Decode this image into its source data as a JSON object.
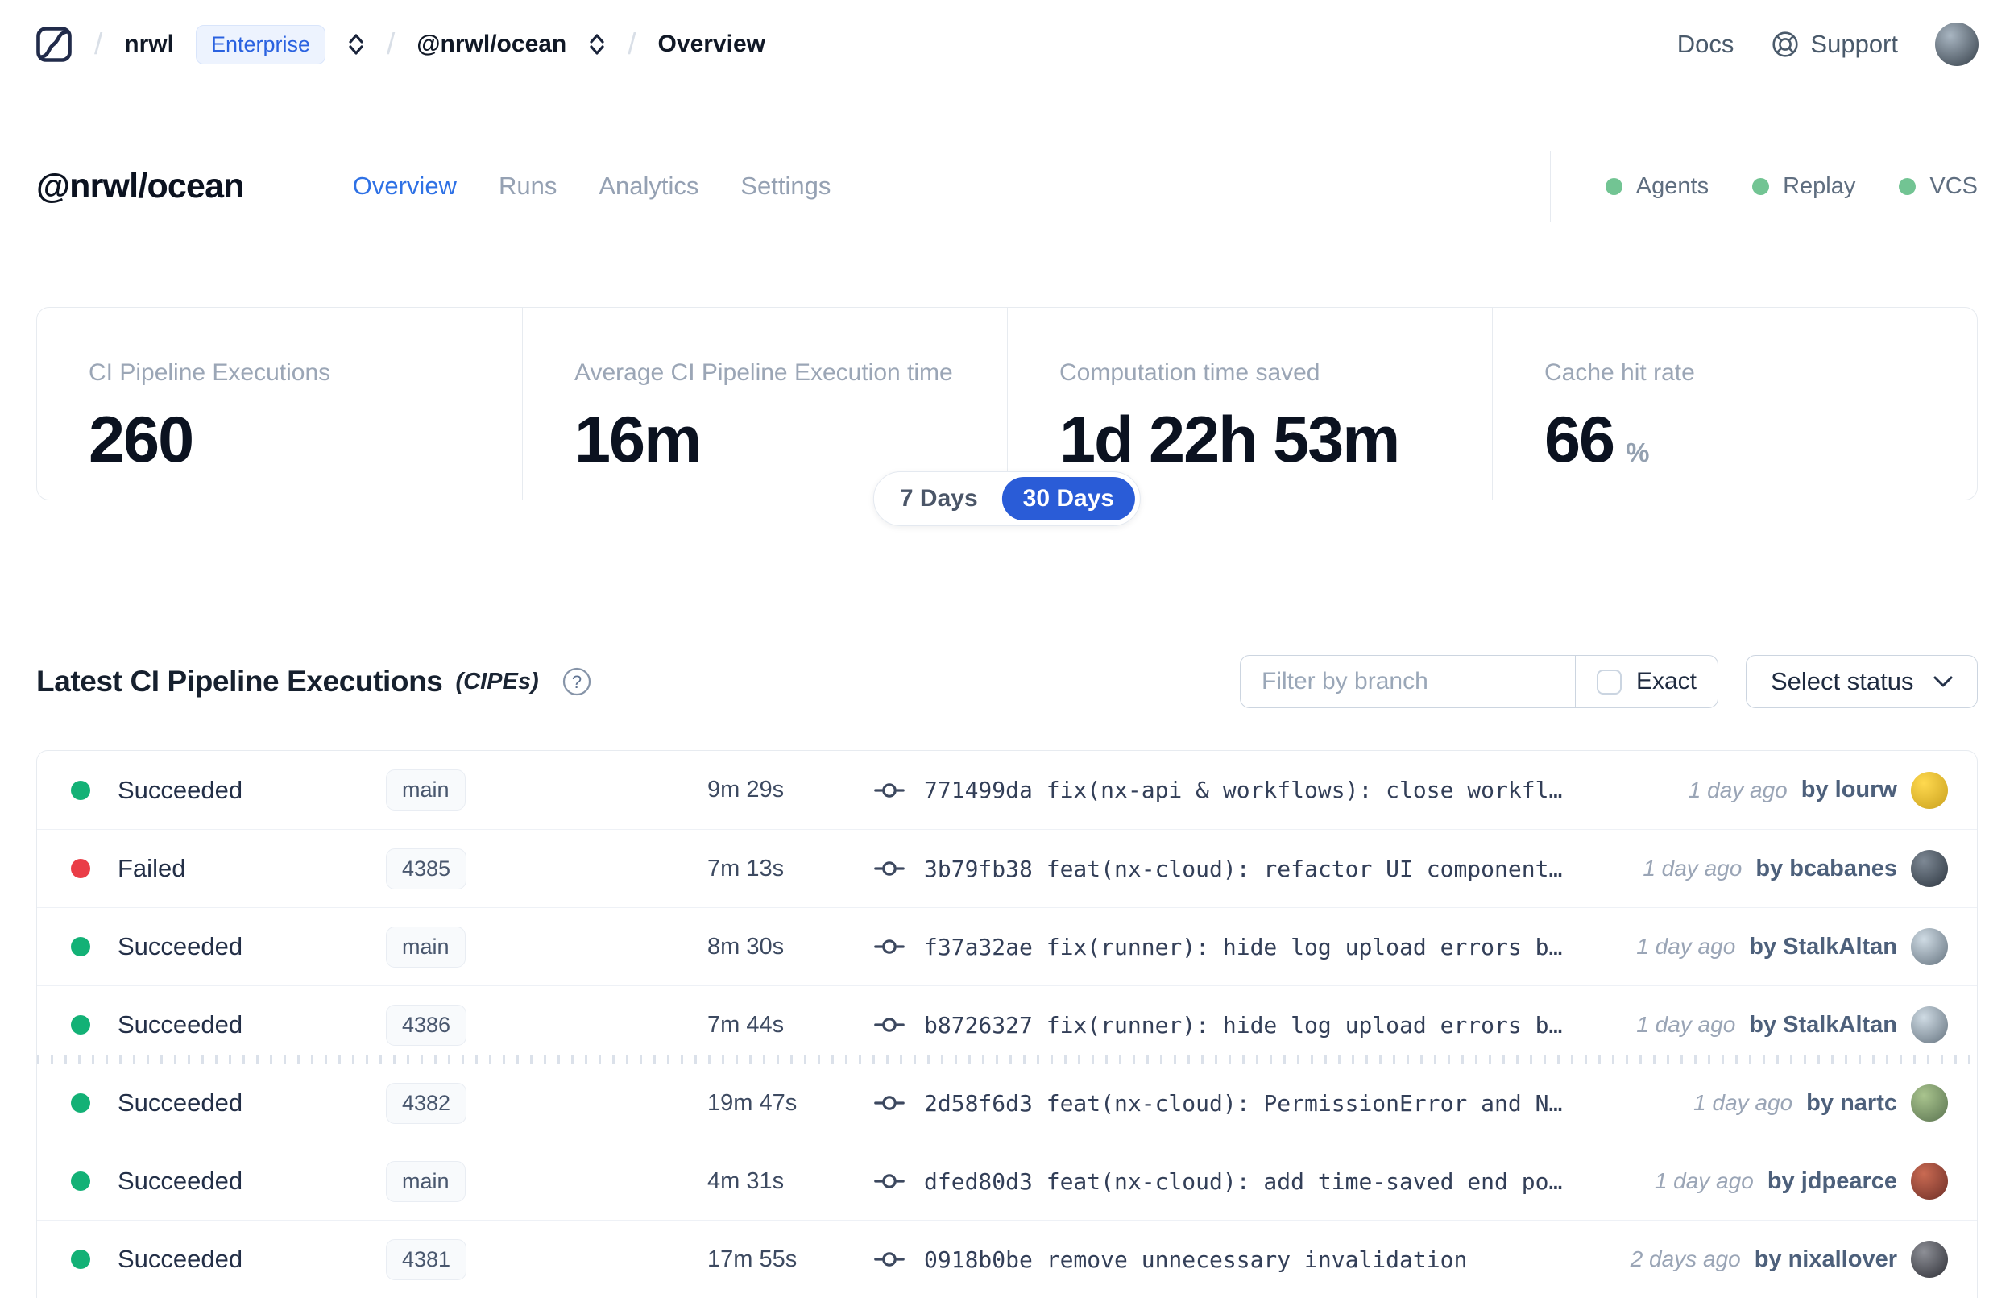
{
  "header": {
    "breadcrumb": {
      "org": "nrwl",
      "org_badge": "Enterprise",
      "workspace": "@nrwl/ocean",
      "page": "Overview"
    },
    "links": {
      "docs": "Docs",
      "support": "Support"
    },
    "avatar_colors": [
      "#a9b6c2",
      "#333d47"
    ]
  },
  "workspace": {
    "title": "@nrwl/ocean",
    "tabs": [
      {
        "label": "Overview",
        "active": true
      },
      {
        "label": "Runs",
        "active": false
      },
      {
        "label": "Analytics",
        "active": false
      },
      {
        "label": "Settings",
        "active": false
      }
    ],
    "legend": [
      {
        "label": "Agents",
        "dot_color": "#72c493"
      },
      {
        "label": "Replay",
        "dot_color": "#72c493"
      },
      {
        "label": "VCS",
        "dot_color": "#72c493"
      }
    ]
  },
  "stats": {
    "cards": [
      {
        "label": "CI Pipeline Executions",
        "value": "260",
        "suffix": ""
      },
      {
        "label": "Average CI Pipeline Execution time",
        "value": "16m",
        "suffix": ""
      },
      {
        "label": "Computation time saved",
        "value": "1d 22h 53m",
        "suffix": ""
      },
      {
        "label": "Cache hit rate",
        "value": "66",
        "suffix": "%"
      }
    ],
    "range_toggle": {
      "options": [
        "7 Days",
        "30 Days"
      ],
      "selected": "30 Days"
    }
  },
  "cipe_section": {
    "title": "Latest CI Pipeline Executions",
    "title_suffix": "(CIPEs)",
    "filter": {
      "placeholder": "Filter by branch",
      "exact_label": "Exact",
      "exact_checked": false,
      "status_button": "Select status"
    },
    "rows": [
      {
        "status": "Succeeded",
        "status_color": "#13b176",
        "branch": "main",
        "duration": "9m 29s",
        "commit": "771499da fix(nx-api & workflows): close workfl…",
        "time": "1 day ago",
        "author": "by lourw",
        "avatar": [
          "#ffd94f",
          "#c9a01d"
        ]
      },
      {
        "status": "Failed",
        "status_color": "#ea3d47",
        "branch": "4385",
        "duration": "7m 13s",
        "commit": "3b79fb38 feat(nx-cloud): refactor UI component…",
        "time": "1 day ago",
        "author": "by bcabanes",
        "avatar": [
          "#7d8894",
          "#2d3640"
        ]
      },
      {
        "status": "Succeeded",
        "status_color": "#13b176",
        "branch": "main",
        "duration": "8m 30s",
        "commit": "f37a32ae fix(runner): hide log upload errors b…",
        "time": "1 day ago",
        "author": "by StalkAltan",
        "avatar": [
          "#cfdbe4",
          "#64727e"
        ]
      },
      {
        "status": "Succeeded",
        "status_color": "#13b176",
        "branch": "4386",
        "duration": "7m 44s",
        "commit": "b8726327 fix(runner): hide log upload errors b…",
        "time": "1 day ago",
        "author": "by StalkAltan",
        "avatar": [
          "#cfdbe4",
          "#64727e"
        ]
      },
      {
        "status": "Succeeded",
        "status_color": "#13b176",
        "branch": "4382",
        "duration": "19m 47s",
        "commit": "2d58f6d3 feat(nx-cloud): PermissionError and N…",
        "time": "1 day ago",
        "author": "by nartc",
        "avatar": [
          "#a9c48e",
          "#5a7350"
        ]
      },
      {
        "status": "Succeeded",
        "status_color": "#13b176",
        "branch": "main",
        "duration": "4m 31s",
        "commit": "dfed80d3 feat(nx-cloud): add time-saved end po…",
        "time": "1 day ago",
        "author": "by jdpearce",
        "avatar": [
          "#c96a52",
          "#6e2f28"
        ]
      },
      {
        "status": "Succeeded",
        "status_color": "#13b176",
        "branch": "4381",
        "duration": "17m 55s",
        "commit": "0918b0be remove unnecessary invalidation",
        "time": "2 days ago",
        "author": "by nixallover",
        "avatar": [
          "#8d8f96",
          "#2e2f36"
        ]
      }
    ]
  }
}
